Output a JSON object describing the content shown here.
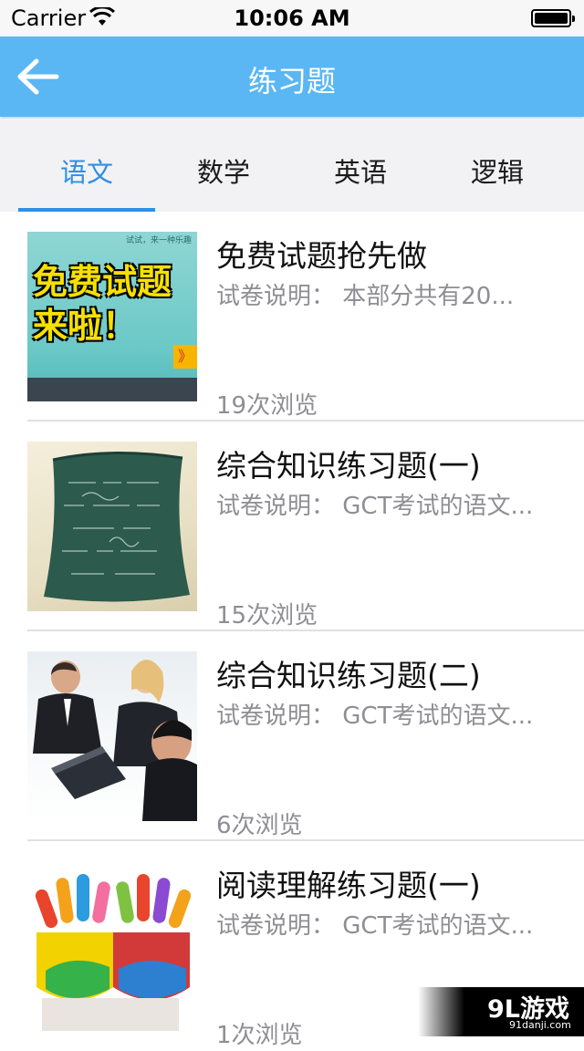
{
  "status_bar": {
    "carrier": "Carrier",
    "time": "10:06 AM"
  },
  "nav": {
    "title": "练习题",
    "back_icon": "back-arrow-icon"
  },
  "tabs": [
    {
      "label": "语文",
      "active": true
    },
    {
      "label": "数学",
      "active": false
    },
    {
      "label": "英语",
      "active": false
    },
    {
      "label": "逻辑",
      "active": false
    }
  ],
  "items": [
    {
      "title": "免费试题抢先做",
      "desc": "试卷说明：  本部分共有20...",
      "views": "19次浏览",
      "thumb": {
        "small_text": "试试，来一种乐趣",
        "line1": "免费试题",
        "line2": "来啦！",
        "tag": "》"
      }
    },
    {
      "title": "综合知识练习题(一)",
      "desc": "试卷说明：  GCT考试的语文...",
      "views": "15次浏览",
      "thumb": "pillow-photo"
    },
    {
      "title": "综合知识练习题(二)",
      "desc": "试卷说明：  GCT考试的语文...",
      "views": "6次浏览",
      "thumb": "business-meeting-photo"
    },
    {
      "title": "阅读理解练习题(一)",
      "desc": "试卷说明：  GCT考试的语文...",
      "views": "1次浏览",
      "thumb": "painted-hands-photo"
    }
  ],
  "watermark": {
    "brand": "9L游戏",
    "url": "91danji.com"
  },
  "colors": {
    "nav_bg": "#5ab7f3",
    "accent": "#2f8fe6",
    "tab_bg": "#f2f2f4",
    "secondary_text": "#8e8e93"
  }
}
